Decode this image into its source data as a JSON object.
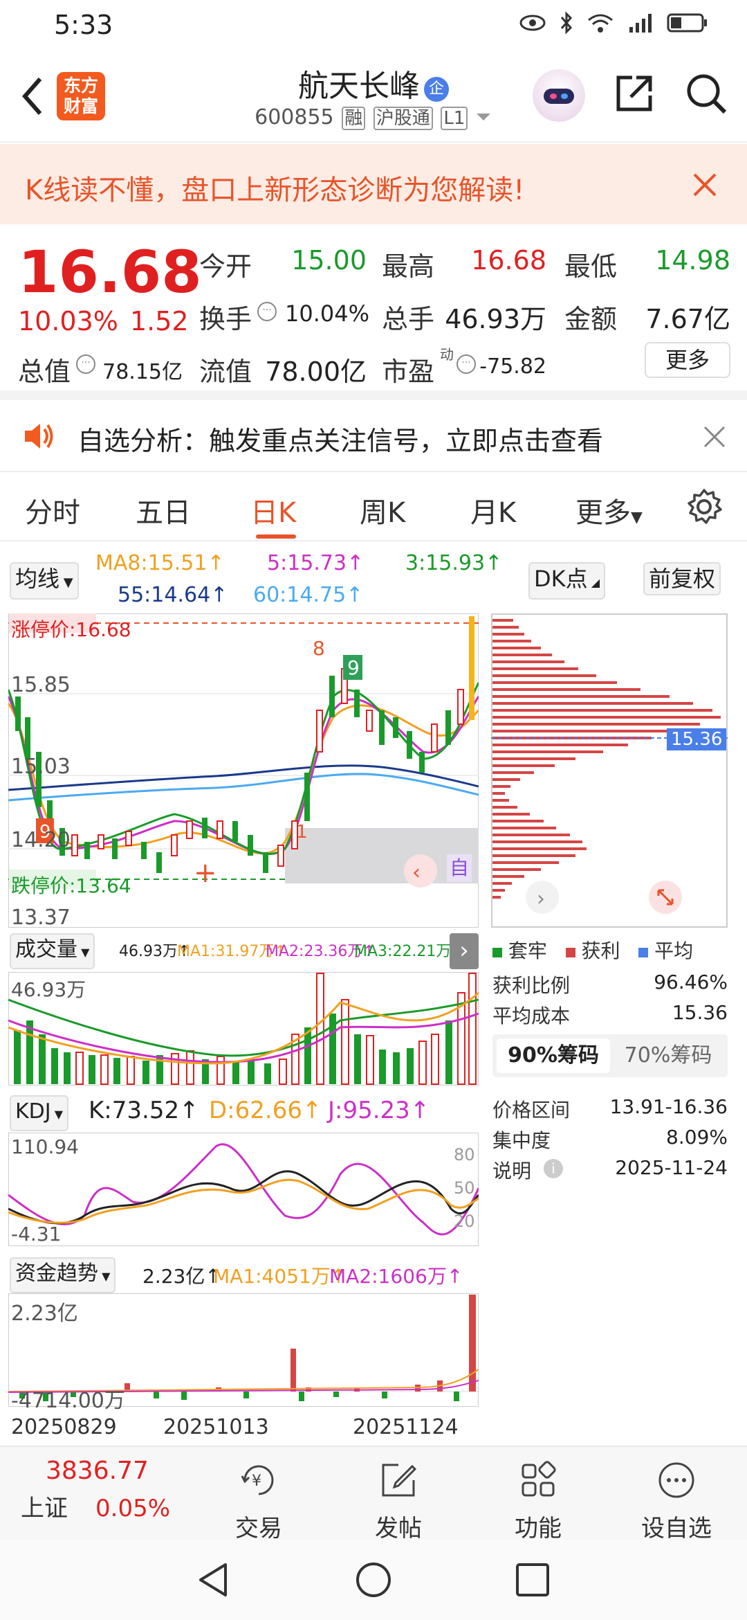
{
  "status": {
    "time": "5:33"
  },
  "header": {
    "logo_line1": "东方",
    "logo_line2": "财富",
    "stock_name": "航天长峰",
    "badge": "企",
    "code": "600855",
    "tag1": "融",
    "tag2": "沪股通",
    "tag3": "L1"
  },
  "banner": {
    "text": "K线读不懂，盘口上新形态诊断为您解读!"
  },
  "quote": {
    "price": "16.68",
    "pct": "10.03%",
    "chg": "1.52",
    "open_l": "今开",
    "open_v": "15.00",
    "high_l": "最高",
    "high_v": "16.68",
    "low_l": "最低",
    "low_v": "14.98",
    "turn_l": "换手",
    "turn_v": "10.04%",
    "vol_l": "总手",
    "vol_v": "46.93万",
    "amt_l": "金额",
    "amt_v": "7.67亿",
    "cap_l": "总值",
    "cap_v": "78.15亿",
    "fcap_l": "流值",
    "fcap_v": "78.00亿",
    "pe_l": "市盈",
    "pe_sup": "动",
    "pe_v": "-75.82",
    "more": "更多"
  },
  "notice": {
    "text": "自选分析：触发重点关注信号，立即点击查看"
  },
  "tabs": [
    "分时",
    "五日",
    "日K",
    "周K",
    "月K",
    "更多"
  ],
  "kline": {
    "selector": "均线",
    "ma8": "MA8:15.51↑",
    "ma5": "5:15.73↑",
    "ma3": "3:15.93↑",
    "ma55": "55:14.64↑",
    "ma60": "60:14.75↑",
    "dk": "DK点",
    "fq": "前复权",
    "limit_up": "涨停价:16.68",
    "limit_down": "跌停价:13.64",
    "y1": "15.85",
    "y2": "15.03",
    "y3": "14.20",
    "y4": "13.37",
    "auto": "自",
    "avg_tag": "15.36"
  },
  "chip": {
    "legend1": "套牢",
    "legend2": "获利",
    "legend3": "平均",
    "profit_l": "获利比例",
    "profit_v": "96.46%",
    "cost_l": "平均成本",
    "cost_v": "15.36",
    "tab1": "90%筹码",
    "tab2": "70%筹码",
    "range_l": "价格区间",
    "range_v": "13.91-16.36",
    "conc_l": "集中度",
    "conc_v": "8.09%",
    "note_l": "说明",
    "note_v": "2025-11-24"
  },
  "volume": {
    "selector": "成交量",
    "v": "46.93万↑",
    "ma1": "MA1:31.97万↑",
    "ma2": "MA2:23.36万↑",
    "ma3": "MA3:22.21万↑",
    "ymax": "46.93万"
  },
  "kdj": {
    "selector": "KDJ",
    "k": "K:73.52↑",
    "d": "D:62.66↑",
    "j": "J:95.23↑",
    "ymax": "110.94",
    "ymin": "-4.31",
    "l80": "80",
    "l50": "50",
    "l20": "20"
  },
  "fund": {
    "selector": "资金趋势",
    "v": "2.23亿↑",
    "ma1": "MA1:4051万↑",
    "ma2": "MA2:1606万↑",
    "ymax": "2.23亿",
    "ymin": "-4714.00万"
  },
  "dates": [
    "20250829",
    "20251013",
    "20251124"
  ],
  "bottom": {
    "index_val": "3836.77",
    "index_name": "上证",
    "index_pct": "0.05%",
    "trade": "交易",
    "post": "发帖",
    "func": "功能",
    "watch": "设自选"
  }
}
